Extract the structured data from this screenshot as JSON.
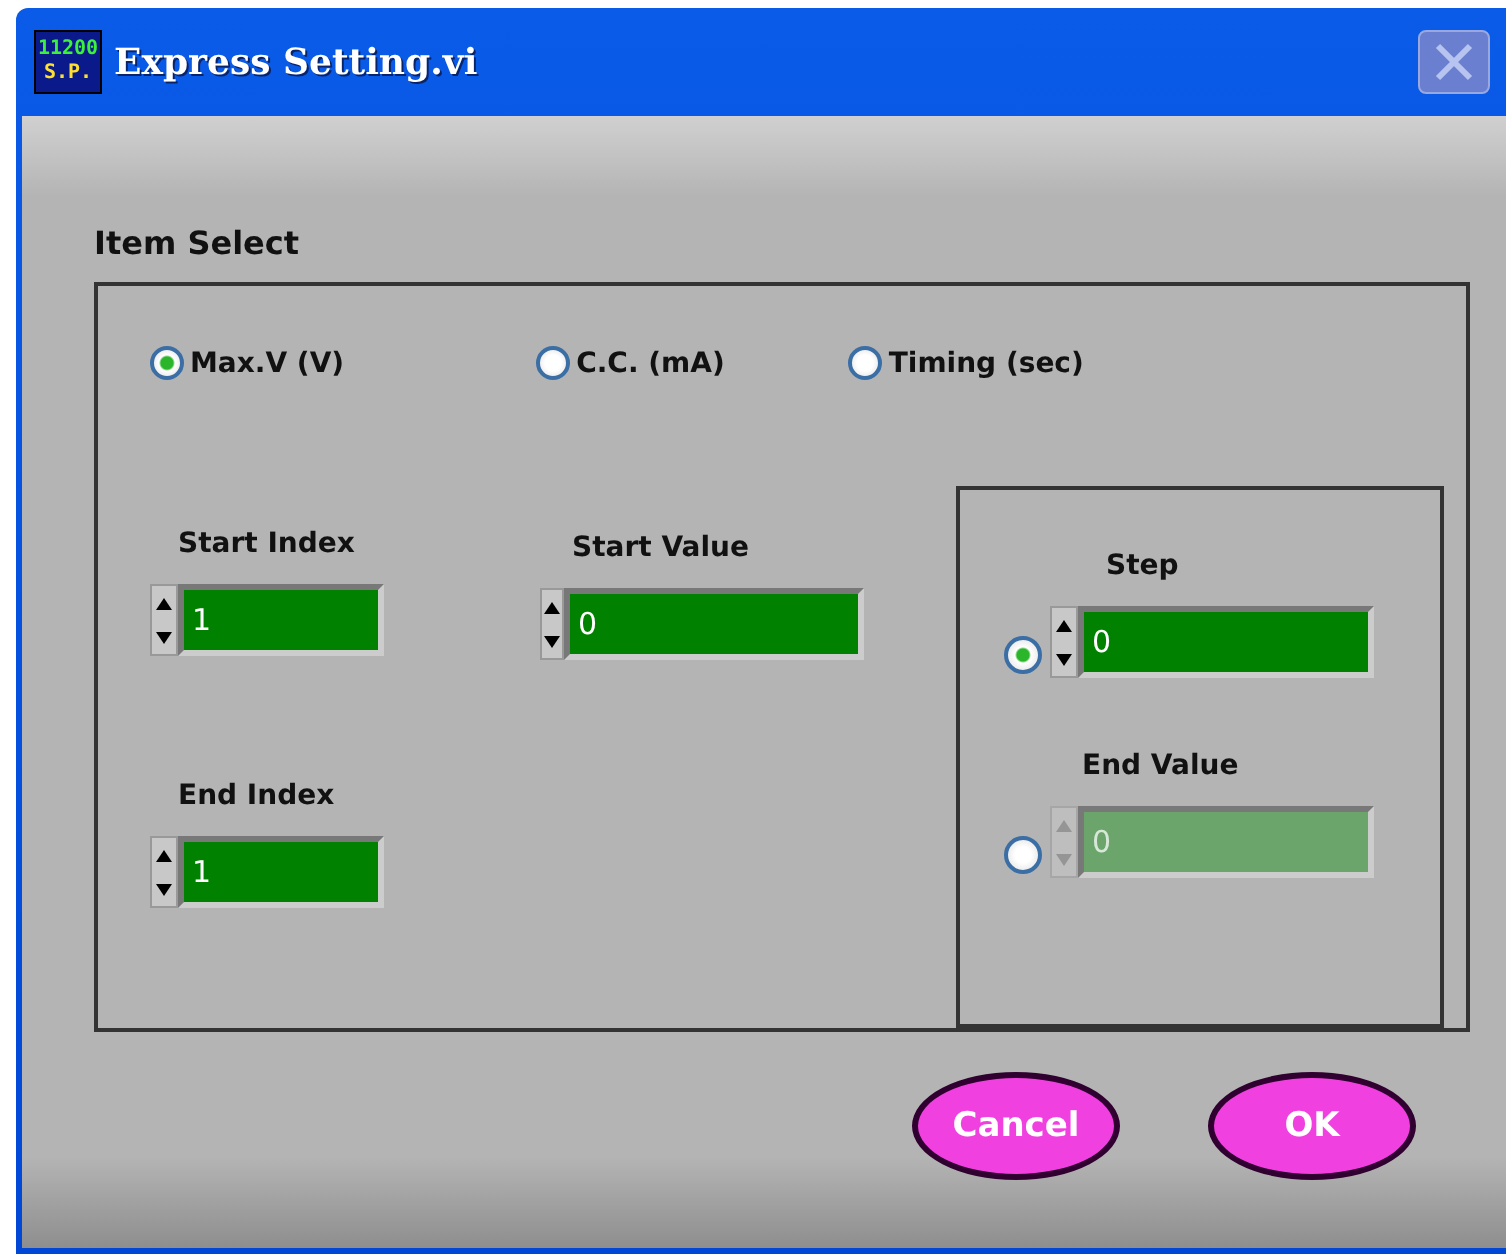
{
  "window": {
    "title": "Express Setting.vi",
    "icon_lines": [
      "11200",
      "S.P."
    ]
  },
  "item_select": {
    "label": "Item Select",
    "options": [
      {
        "label": "Max.V (V)",
        "selected": true
      },
      {
        "label": "C.C. (mA)",
        "selected": false
      },
      {
        "label": "Timing (sec)",
        "selected": false
      }
    ]
  },
  "fields": {
    "start_index": {
      "label": "Start Index",
      "value": "1"
    },
    "start_value": {
      "label": "Start Value",
      "value": "0"
    },
    "end_index": {
      "label": "End Index",
      "value": "1"
    }
  },
  "mode_group": [
    {
      "label": "Step",
      "value": "0",
      "selected": true,
      "disabled": false
    },
    {
      "label": "End Value",
      "value": "0",
      "selected": false,
      "disabled": true
    }
  ],
  "buttons": [
    "Cancel",
    "OK"
  ]
}
